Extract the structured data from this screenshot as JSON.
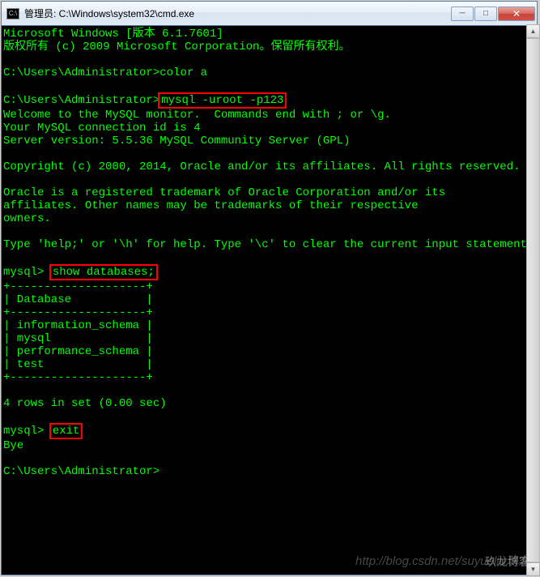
{
  "window": {
    "title": "管理员: C:\\Windows\\system32\\cmd.exe",
    "icon_text": "C:\\"
  },
  "terminal": {
    "line1": "Microsoft Windows [版本 6.1.7601]",
    "line2": "版权所有 (c) 2009 Microsoft Corporation。保留所有权利。",
    "prompt1": "C:\\Users\\Administrator>",
    "cmd1": "color a",
    "prompt2": "C:\\Users\\Administrator>",
    "cmd2": "mysql -uroot -p123",
    "welcome1": "Welcome to the MySQL monitor.  Commands end with ; or \\g.",
    "welcome2": "Your MySQL connection id is 4",
    "welcome3": "Server version: 5.5.36 MySQL Community Server (GPL)",
    "copyright": "Copyright (c) 2000, 2014, Oracle and/or its affiliates. All rights reserved.",
    "trademark1": "Oracle is a registered trademark of Oracle Corporation and/or its",
    "trademark2": "affiliates. Other names may be trademarks of their respective",
    "trademark3": "owners.",
    "help": "Type 'help;' or '\\h' for help. Type '\\c' to clear the current input statement.",
    "mysql_prompt1": "mysql> ",
    "cmd3": "show databases;",
    "table_border": "+--------------------+",
    "table_header": "| Database           |",
    "table_row1": "| information_schema |",
    "table_row2": "| mysql              |",
    "table_row3": "| performance_schema |",
    "table_row4": "| test               |",
    "rows_msg": "4 rows in set (0.00 sec)",
    "mysql_prompt2": "mysql> ",
    "cmd4": "exit",
    "bye": "Bye",
    "prompt3": "C:\\Users\\Administrator>"
  },
  "watermark": "http://blog.csdn.net/suyueliu玖龙",
  "watermark2": "玖龙博客"
}
